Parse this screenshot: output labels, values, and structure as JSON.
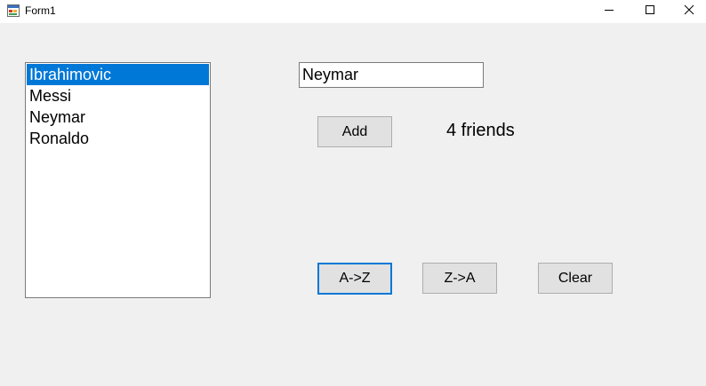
{
  "window": {
    "title": "Form1",
    "icon": "form-app-icon",
    "controls": {
      "minimize": "minimize-icon",
      "maximize": "maximize-icon",
      "close": "close-icon"
    }
  },
  "friends_list": {
    "items": [
      "Ibrahimovic",
      "Messi",
      "Neymar",
      "Ronaldo"
    ],
    "selected_index": 0
  },
  "name_input": {
    "value": "Neymar"
  },
  "buttons": {
    "add": "Add",
    "sort_asc": "A->Z",
    "sort_desc": "Z->A",
    "clear": "Clear"
  },
  "count_label": "4 friends",
  "colors": {
    "selection": "#0078d7",
    "form_background": "#f0f0f0",
    "button_face": "#e1e1e1"
  }
}
